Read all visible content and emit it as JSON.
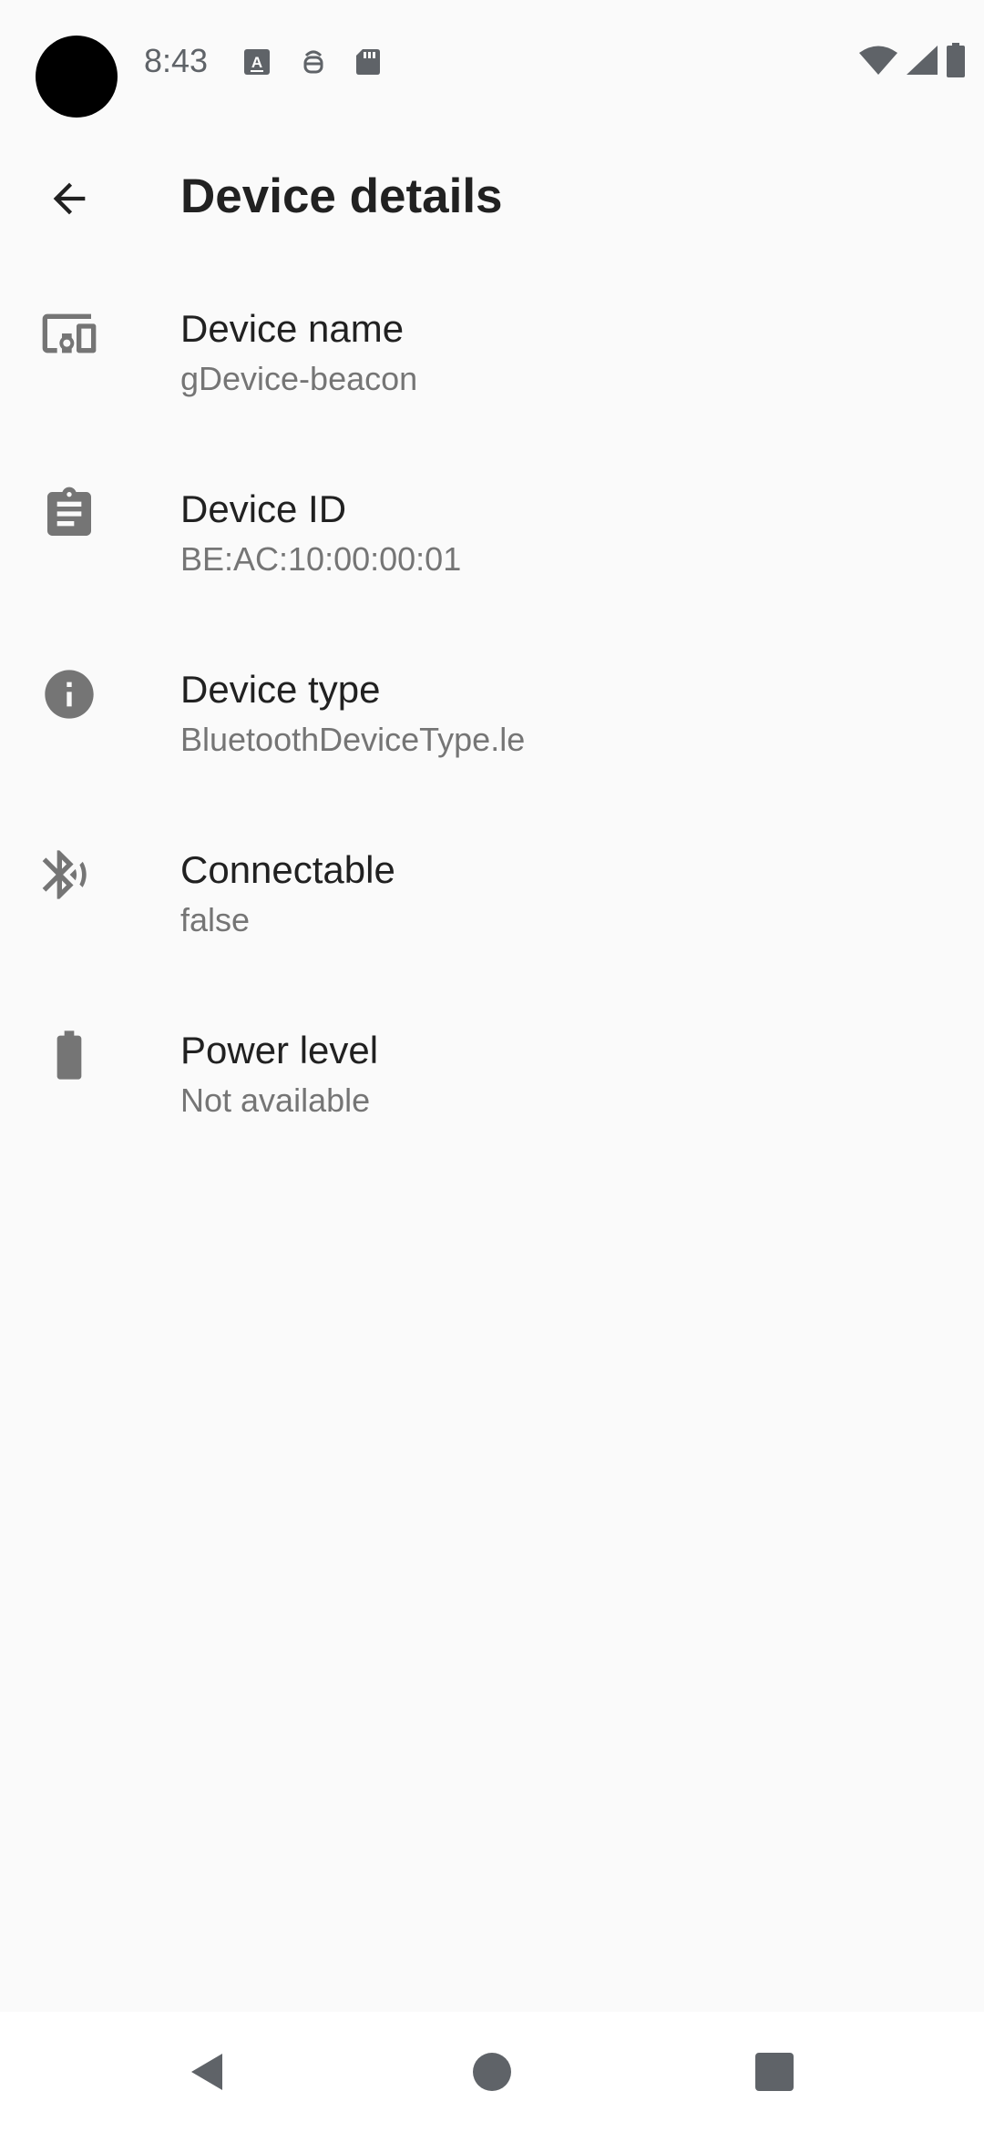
{
  "status_bar": {
    "time": "8:43"
  },
  "app_bar": {
    "title": "Device details"
  },
  "details": [
    {
      "icon": "devices-icon",
      "title": "Device name",
      "value": "gDevice-beacon"
    },
    {
      "icon": "clipboard-icon",
      "title": "Device ID",
      "value": "BE:AC:10:00:00:01"
    },
    {
      "icon": "info-icon",
      "title": "Device type",
      "value": "BluetoothDeviceType.le"
    },
    {
      "icon": "bluetooth-icon",
      "title": "Connectable",
      "value": "false"
    },
    {
      "icon": "battery-icon",
      "title": "Power level",
      "value": "Not available"
    }
  ],
  "colors": {
    "background": "#fafafa",
    "icon": "#757575",
    "title_text": "#212121",
    "subtitle_text": "#757575",
    "nav_bar": "#ffffff"
  }
}
